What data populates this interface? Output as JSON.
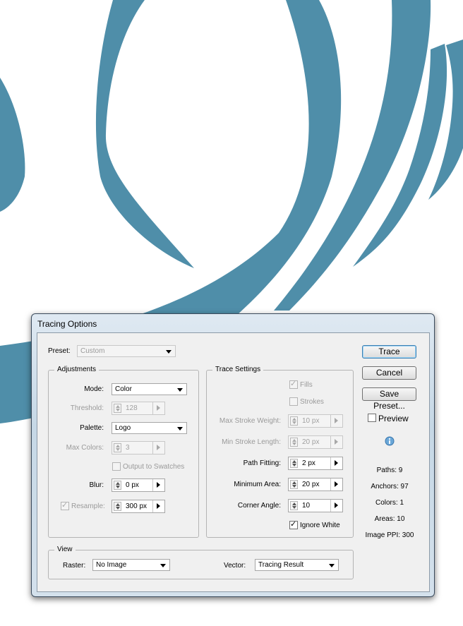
{
  "dialog": {
    "title": "Tracing Options"
  },
  "preset": {
    "label": "Preset:",
    "value": "Custom"
  },
  "adjustments": {
    "title": "Adjustments",
    "mode": {
      "label": "Mode:",
      "value": "Color"
    },
    "threshold": {
      "label": "Threshold:",
      "value": "128"
    },
    "palette": {
      "label": "Palette:",
      "value": "Logo"
    },
    "max_colors": {
      "label": "Max Colors:",
      "value": "3"
    },
    "output_to_swatches": {
      "label": "Output to Swatches",
      "checked": false
    },
    "blur": {
      "label": "Blur:",
      "value": "0 px"
    },
    "resample": {
      "label": "Resample:",
      "value": "300 px",
      "checked": true
    }
  },
  "trace_settings": {
    "title": "Trace Settings",
    "fills": {
      "label": "Fills",
      "checked": true
    },
    "strokes": {
      "label": "Strokes",
      "checked": false
    },
    "max_stroke_weight": {
      "label": "Max Stroke Weight:",
      "value": "10 px"
    },
    "min_stroke_length": {
      "label": "Min Stroke Length:",
      "value": "20 px"
    },
    "path_fitting": {
      "label": "Path Fitting:",
      "value": "2 px"
    },
    "minimum_area": {
      "label": "Minimum Area:",
      "value": "20 px"
    },
    "corner_angle": {
      "label": "Corner Angle:",
      "value": "10"
    },
    "ignore_white": {
      "label": "Ignore White",
      "checked": true
    }
  },
  "view": {
    "title": "View",
    "raster": {
      "label": "Raster:",
      "value": "No Image"
    },
    "vector": {
      "label": "Vector:",
      "value": "Tracing Result"
    }
  },
  "buttons": {
    "trace": "Trace",
    "cancel": "Cancel",
    "save_preset": "Save Preset..."
  },
  "preview": {
    "label": "Preview",
    "checked": false
  },
  "stats": {
    "paths": "Paths: 9",
    "anchors": "Anchors: 97",
    "colors": "Colors: 1",
    "areas": "Areas: 10",
    "image_ppi": "Image PPI: 300"
  },
  "colors": {
    "artwork": "#4f8ea9",
    "default_button_border": "#3c7fb1"
  },
  "icons": {
    "info": "info-icon",
    "dropdown": "chevron-down-icon",
    "spin": "spinner-icon"
  }
}
